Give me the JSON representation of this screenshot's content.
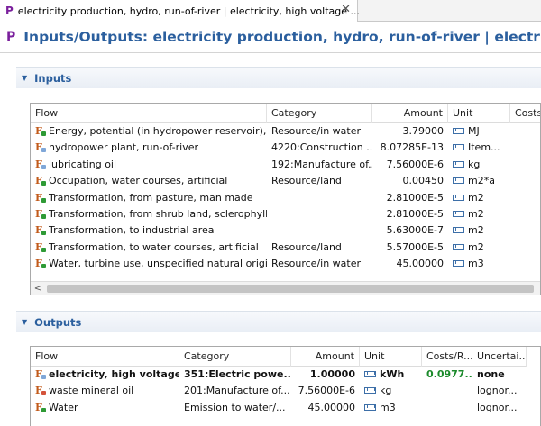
{
  "tab": {
    "icon": "process-icon",
    "title": "electricity production, hydro, run-of-river | electricity, high voltage ...",
    "close_glyph": "✕"
  },
  "editor": {
    "icon_letter": "P",
    "title": "Inputs/Outputs: electricity production, hydro, run-of-river | electricity, high voltage"
  },
  "inputs": {
    "label": "Inputs",
    "columns": [
      "Flow",
      "Category",
      "Amount",
      "Unit",
      "Costs"
    ],
    "rows": [
      {
        "flow": "Energy, potential (in hydropower reservoir), ...",
        "type": "elementary",
        "category": "Resource/in water",
        "amount": "3.79000",
        "unit": "MJ"
      },
      {
        "flow": "hydropower plant, run-of-river",
        "type": "product",
        "category": "4220:Construction ...",
        "amount": "8.07285E-13",
        "unit": "Item..."
      },
      {
        "flow": "lubricating oil",
        "type": "product",
        "category": "192:Manufacture of...",
        "amount": "7.56000E-6",
        "unit": "kg"
      },
      {
        "flow": "Occupation, water courses, artificial",
        "type": "elementary",
        "category": "Resource/land",
        "amount": "0.00450",
        "unit": "m2*a"
      },
      {
        "flow": "Transformation, from pasture, man made",
        "type": "elementary",
        "category": "",
        "amount": "2.81000E-5",
        "unit": "m2"
      },
      {
        "flow": "Transformation, from shrub land, sclerophyll...",
        "type": "elementary",
        "category": "",
        "amount": "2.81000E-5",
        "unit": "m2"
      },
      {
        "flow": "Transformation, to industrial area",
        "type": "elementary",
        "category": "",
        "amount": "5.63000E-7",
        "unit": "m2"
      },
      {
        "flow": "Transformation, to water courses, artificial",
        "type": "elementary",
        "category": "Resource/land",
        "amount": "5.57000E-5",
        "unit": "m2"
      },
      {
        "flow": "Water, turbine use, unspecified natural origin",
        "type": "elementary",
        "category": "Resource/in water",
        "amount": "45.00000",
        "unit": "m3"
      }
    ]
  },
  "outputs": {
    "label": "Outputs",
    "columns": [
      "Flow",
      "Category",
      "Amount",
      "Unit",
      "Costs/R...",
      "Uncertai..."
    ],
    "rows": [
      {
        "flow": "electricity, high voltage",
        "type": "product",
        "category": "351:Electric powe...",
        "amount": "1.00000",
        "unit": "kWh",
        "costs": "0.0977...",
        "uncertainty": "none",
        "bold": true
      },
      {
        "flow": "waste mineral oil",
        "type": "waste",
        "category": "201:Manufacture of...",
        "amount": "7.56000E-6",
        "unit": "kg",
        "costs": "",
        "uncertainty": "lognor..."
      },
      {
        "flow": "Water",
        "type": "elementary",
        "category": "Emission to water/...",
        "amount": "45.00000",
        "unit": "m3",
        "costs": "",
        "uncertainty": "lognor..."
      }
    ]
  },
  "colors": {
    "title_blue": "#2b5f9e",
    "process_purple": "#7a1f9c",
    "cost_green": "#1b8a2b"
  },
  "scroll": {
    "left_arrow": "<"
  }
}
